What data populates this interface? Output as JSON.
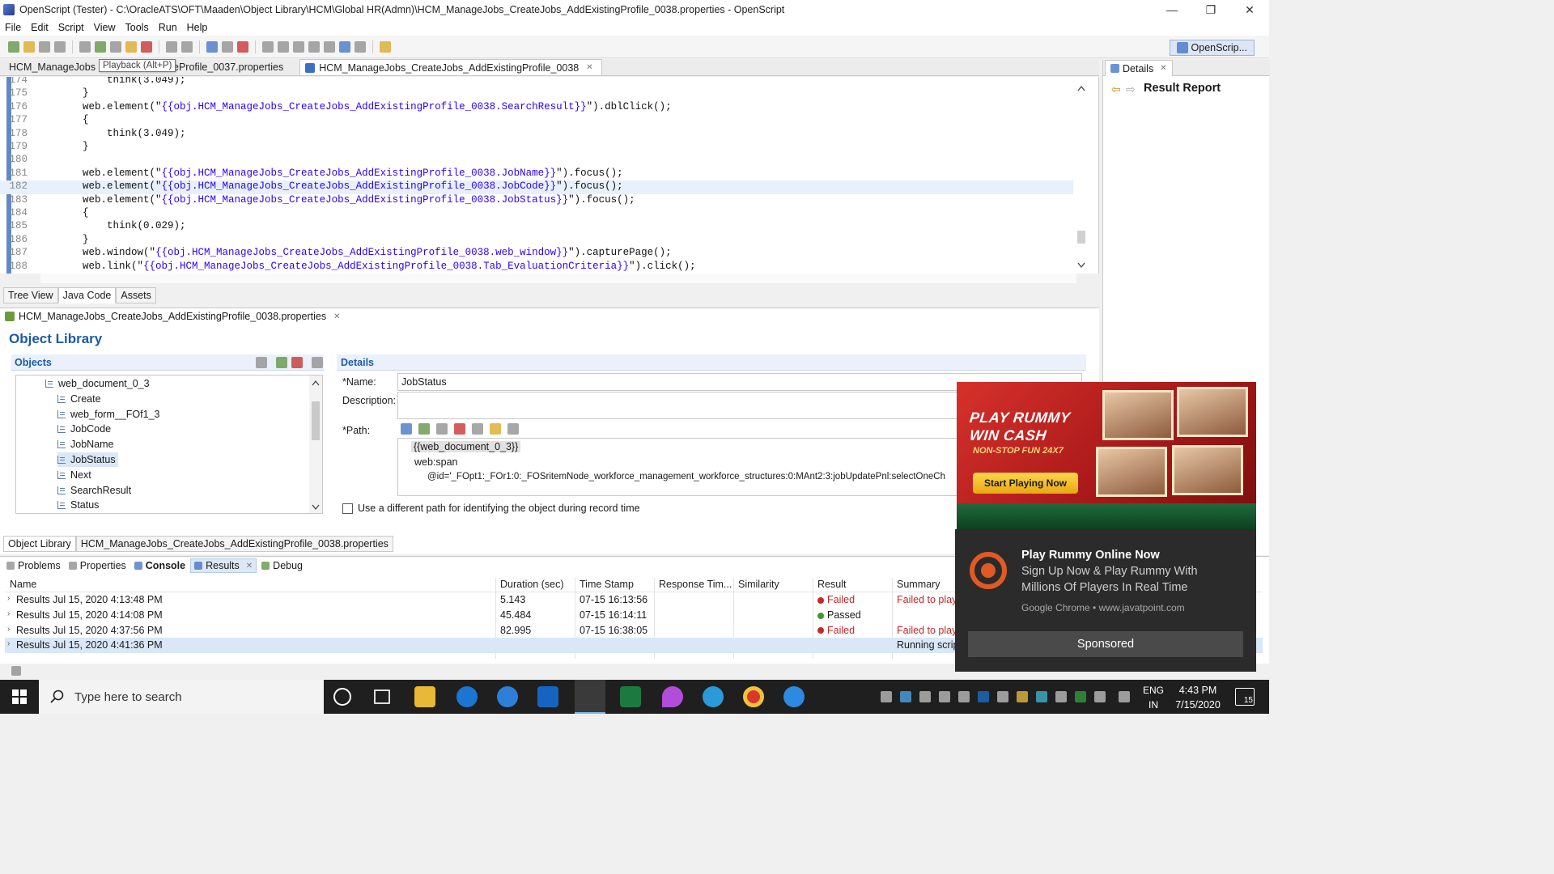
{
  "window": {
    "title": "OpenScript (Tester) - C:\\OracleATS\\OFT\\Maaden\\Object Library\\HCM\\Global HR(Admn)\\HCM_ManageJobs_CreateJobs_AddExistingProfile_0038.properties - OpenScript",
    "minimize": "—",
    "maximize": "❐",
    "close": "✕"
  },
  "menu": [
    "File",
    "Edit",
    "Script",
    "View",
    "Tools",
    "Run",
    "Help"
  ],
  "toolbar": {
    "perspective_label": "OpenScrip..."
  },
  "editor_tabs": [
    {
      "label": "HCM_ManageJobs",
      "active": false
    },
    {
      "label": "eProfile_0037.properties",
      "active": false
    },
    {
      "label": "HCM_ManageJobs_CreateJobs_AddExistingProfile_0038",
      "active": true
    }
  ],
  "tooltip": "Playback (Alt+P)",
  "code": [
    {
      "n": "174",
      "pre": "            think(3.049);",
      "str": "",
      "post": ""
    },
    {
      "n": "175",
      "pre": "        }",
      "str": "",
      "post": ""
    },
    {
      "n": "176",
      "pre": "        web.element(\"",
      "str": "{{obj.HCM_ManageJobs_CreateJobs_AddExistingProfile_0038.SearchResult}}",
      "post": "\").dblClick();"
    },
    {
      "n": "177",
      "pre": "        {",
      "str": "",
      "post": ""
    },
    {
      "n": "178",
      "pre": "            think(3.049);",
      "str": "",
      "post": ""
    },
    {
      "n": "179",
      "pre": "        }",
      "str": "",
      "post": ""
    },
    {
      "n": "180",
      "pre": "",
      "str": "",
      "post": ""
    },
    {
      "n": "181",
      "pre": "        web.element(\"",
      "str": "{{obj.HCM_ManageJobs_CreateJobs_AddExistingProfile_0038.JobName}}",
      "post": "\").focus();"
    },
    {
      "n": "182",
      "pre": "        web.element(\"",
      "str": "{{obj.HCM_ManageJobs_CreateJobs_AddExistingProfile_0038.JobCode}}",
      "post": "\").focus();",
      "hl": true
    },
    {
      "n": "183",
      "pre": "        web.element(\"",
      "str": "{{obj.HCM_ManageJobs_CreateJobs_AddExistingProfile_0038.JobStatus}}",
      "post": "\").focus();"
    },
    {
      "n": "184",
      "pre": "        {",
      "str": "",
      "post": ""
    },
    {
      "n": "185",
      "pre": "            think(0.029);",
      "str": "",
      "post": ""
    },
    {
      "n": "186",
      "pre": "        }",
      "str": "",
      "post": ""
    },
    {
      "n": "187",
      "pre": "        web.window(\"",
      "str": "{{obj.HCM_ManageJobs_CreateJobs_AddExistingProfile_0038.web_window}}",
      "post": "\").capturePage();"
    },
    {
      "n": "188",
      "pre": "        web.link(\"",
      "str": "{{obj.HCM_ManageJobs_CreateJobs_AddExistingProfile_0038.Tab_EvaluationCriteria}}",
      "post": "\").click();"
    }
  ],
  "view_tabs": [
    "Tree View",
    "Java Code",
    "Assets"
  ],
  "object_library": {
    "file_tab": "HCM_ManageJobs_CreateJobs_AddExistingProfile_0038.properties",
    "title": "Object Library",
    "objects_header": "Objects",
    "tree": [
      {
        "label": "web_document_0_3",
        "indent": 0
      },
      {
        "label": "Create",
        "indent": 1
      },
      {
        "label": "web_form__FOf1_3",
        "indent": 1
      },
      {
        "label": "JobCode",
        "indent": 1
      },
      {
        "label": "JobName",
        "indent": 1
      },
      {
        "label": "JobStatus",
        "indent": 1,
        "selected": true
      },
      {
        "label": "Next",
        "indent": 1
      },
      {
        "label": "SearchResult",
        "indent": 1
      },
      {
        "label": "Status",
        "indent": 1
      }
    ],
    "details_header": "Details",
    "name_label": "*Name:",
    "name_value": "JobStatus",
    "description_label": "Description:",
    "description_value": "",
    "path_label": "*Path:",
    "path_lines": [
      "{{web_document_0_3}}",
      "web:span",
      "@id='_FOpt1:_FOr1:0:_FOSritemNode_workforce_management_workforce_structures:0:MAnt2:3:jobUpdatePnl:selectOneCh"
    ],
    "checkbox_label": "Use a different path for identifying the object during record time",
    "bottom_tabs": [
      "Object Library",
      "HCM_ManageJobs_CreateJobs_AddExistingProfile_0038.properties"
    ]
  },
  "right_pane": {
    "tab": "Details",
    "title": "Result Report"
  },
  "results": {
    "tabs": [
      "Problems",
      "Properties",
      "Console",
      "Results",
      "Debug"
    ],
    "columns": [
      "Name",
      "Duration (sec)",
      "Time Stamp",
      "Response Tim...",
      "Similarity",
      "Result",
      "Summary"
    ],
    "rows": [
      {
        "name": "Results Jul 15, 2020 4:13:48 PM",
        "duration": "5.143",
        "timestamp": "07-15 16:13:56",
        "result": "Failed",
        "status_color": "#c62828",
        "summary": "Failed to play"
      },
      {
        "name": "Results Jul 15, 2020 4:14:08 PM",
        "duration": "45.484",
        "timestamp": "07-15 16:14:11",
        "result": "Passed",
        "status_color": "#3c9a2f",
        "summary": ""
      },
      {
        "name": "Results Jul 15, 2020 4:37:56 PM",
        "duration": "82.995",
        "timestamp": "07-15 16:38:05",
        "result": "Failed",
        "status_color": "#c62828",
        "summary": "Failed to play"
      },
      {
        "name": "Results Jul 15, 2020 4:41:36 PM",
        "duration": "",
        "timestamp": "",
        "result": "",
        "status_color": "",
        "summary": "Running scrip",
        "selected": true
      }
    ]
  },
  "ad": {
    "headline1": "PLAY RUMMY",
    "headline2": "WIN CASH",
    "tagline": "NON-STOP FUN 24X7",
    "cta": "Start Playing Now"
  },
  "notification": {
    "title": "Play Rummy Online Now",
    "body1": "Sign Up Now & Play Rummy With",
    "body2": "Millions Of Players In Real Time",
    "source": "Google Chrome • www.javatpoint.com",
    "button": "Sponsored"
  },
  "taskbar": {
    "search_placeholder": "Type here to search",
    "lang1": "ENG",
    "lang2": "IN",
    "time": "4:43 PM",
    "date": "7/15/2020",
    "notif_count": "15"
  }
}
